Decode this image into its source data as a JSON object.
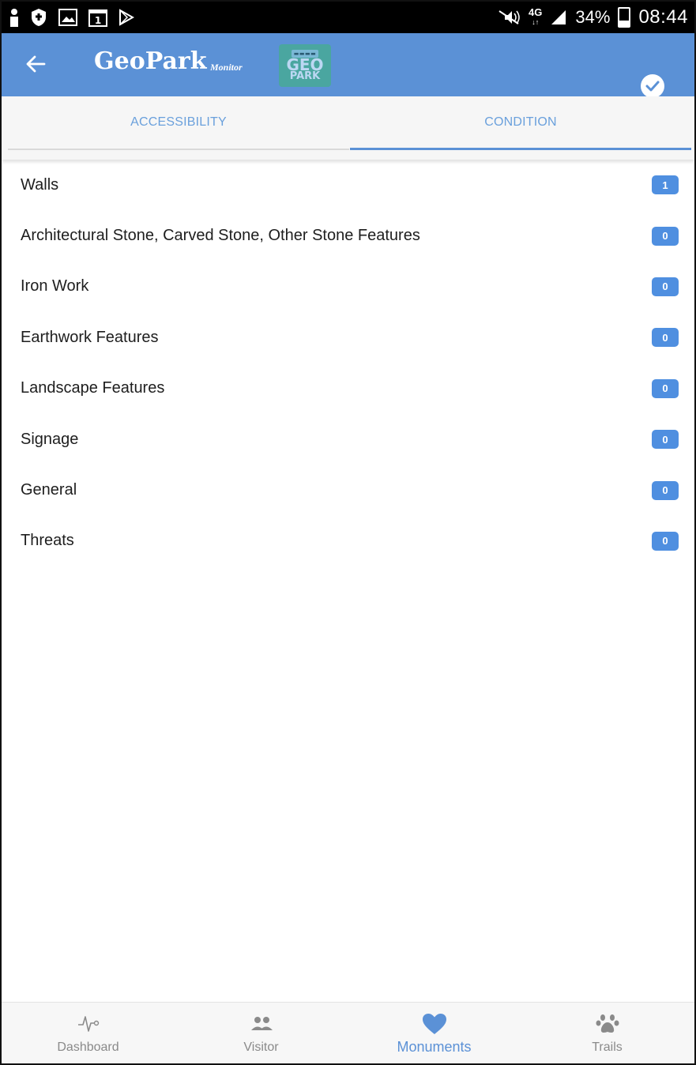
{
  "status_bar": {
    "battery": "34%",
    "time": "08:44",
    "network": "4G",
    "icons": [
      "person-icon",
      "shield-icon",
      "image-icon",
      "calendar-icon",
      "play-store-icon",
      "mute-icon",
      "signal-icon",
      "battery-icon"
    ]
  },
  "app_bar": {
    "title": "GeoPark",
    "subtitle": "Monitor",
    "back_icon": "arrow-left-icon",
    "check_icon": "check-circle-icon"
  },
  "tabs": [
    {
      "label": "ACCESSIBILITY",
      "selected": false
    },
    {
      "label": "CONDITION",
      "selected": true
    }
  ],
  "list": [
    {
      "label": "Walls",
      "count": "1"
    },
    {
      "label": "Architectural Stone, Carved Stone, Other Stone Features",
      "count": "0"
    },
    {
      "label": "Iron Work",
      "count": "0"
    },
    {
      "label": "Earthwork Features",
      "count": "0"
    },
    {
      "label": "Landscape Features",
      "count": "0"
    },
    {
      "label": "Signage",
      "count": "0"
    },
    {
      "label": "General",
      "count": "0"
    },
    {
      "label": "Threats",
      "count": "0"
    }
  ],
  "bottom_nav": [
    {
      "label": "Dashboard",
      "icon": "pulse-icon",
      "active": false
    },
    {
      "label": "Visitor",
      "icon": "people-icon",
      "active": false
    },
    {
      "label": "Monuments",
      "icon": "heart-icon",
      "active": true
    },
    {
      "label": "Trails",
      "icon": "paw-icon",
      "active": false
    }
  ],
  "colors": {
    "primary": "#5b91d6",
    "badge": "#4f8fe0",
    "tab_text": "#6aa0dc",
    "status_bar": "#000000"
  }
}
